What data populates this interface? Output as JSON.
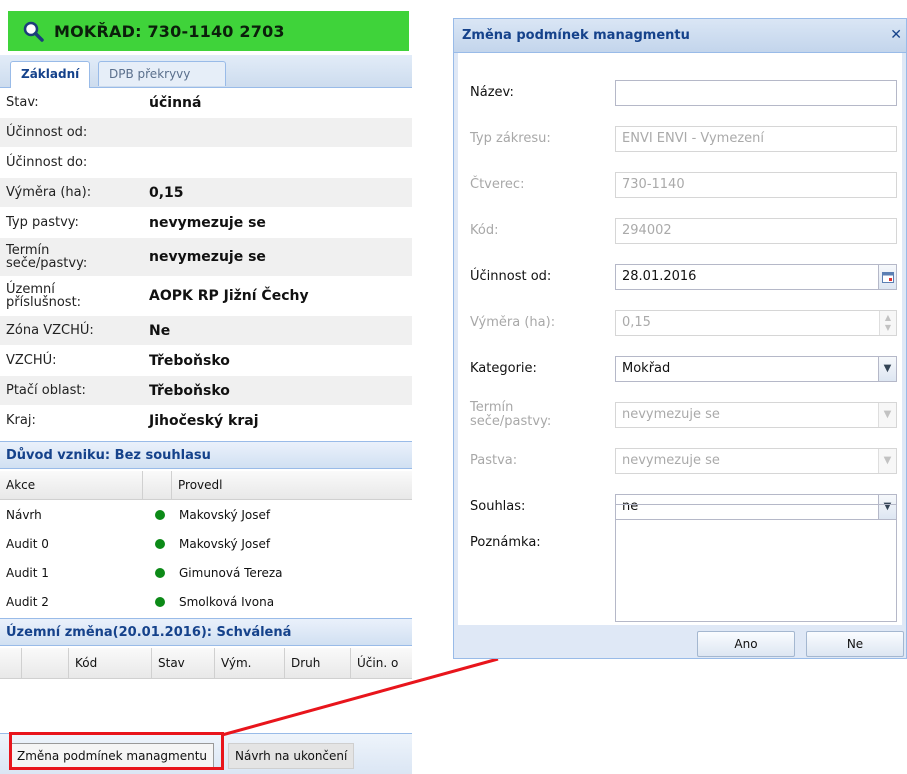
{
  "left": {
    "title": "MOKŘAD: 730-1140 2703",
    "tabs": [
      "Základní",
      "DPB překryvy"
    ],
    "properties": [
      {
        "label": "Stav:",
        "value": "účinná"
      },
      {
        "label": "Účinnost od:",
        "value": ""
      },
      {
        "label": "Účinnost do:",
        "value": ""
      },
      {
        "label": "Výměra (ha):",
        "value": "0,15"
      },
      {
        "label": "Typ pastvy:",
        "value": "nevymezuje se"
      },
      {
        "label": "Termín seče/pastvy:",
        "value": "nevymezuje se"
      },
      {
        "label": "Územní příslušnost:",
        "value": "AOPK RP Jižní Čechy"
      },
      {
        "label": "Zóna VZCHÚ:",
        "value": "Ne"
      },
      {
        "label": "VZCHÚ:",
        "value": "Třeboňsko"
      },
      {
        "label": "Ptačí oblast:",
        "value": "Třeboňsko"
      },
      {
        "label": "Kraj:",
        "value": "Jihočeský kraj"
      }
    ],
    "duvod_header": "Důvod vzniku: Bez souhlasu",
    "audit_columns": [
      "Akce",
      "Provedl"
    ],
    "audit_rows": [
      {
        "akce": "Návrh",
        "provedl": "Makovský Josef"
      },
      {
        "akce": "Audit 0",
        "provedl": "Makovský Josef"
      },
      {
        "akce": "Audit 1",
        "provedl": "Gimunová Tereza"
      },
      {
        "akce": "Audit 2",
        "provedl": "Smolková Ivona"
      }
    ],
    "status_color": "#0c8a17",
    "zmena_header": "Územní změna(20.01.2016): Schválená",
    "zmena_columns": [
      "",
      "Kód",
      "Stav",
      "Vým.",
      "Druh",
      "Účin. o"
    ],
    "toolbar": {
      "zmena_btn": "Změna podmínek managmentu",
      "navrh_btn": "Návrh na ukončení"
    }
  },
  "dialog": {
    "title": "Změna podmínek managmentu",
    "close_glyph": "✕",
    "fields": {
      "nazev": {
        "label": "Název:",
        "value": ""
      },
      "typ": {
        "label": "Typ zákresu:",
        "value": "ENVI ENVI - Vymezení"
      },
      "ctverec": {
        "label": "Čtverec:",
        "value": "730-1140"
      },
      "kod": {
        "label": "Kód:",
        "value": "294002"
      },
      "ucinnost": {
        "label": "Účinnost od:",
        "value": "28.01.2016"
      },
      "vymera": {
        "label": "Výměra (ha):",
        "value": "0,15"
      },
      "kategorie": {
        "label": "Kategorie:",
        "value": "Mokřad"
      },
      "termin": {
        "label": "Termín seče/pastvy:",
        "value": "nevymezuje se"
      },
      "pastva": {
        "label": "Pastva:",
        "value": "nevymezuje se"
      },
      "souhlas": {
        "label": "Souhlas:",
        "value": "ne"
      },
      "poznamka": {
        "label": "Poznámka:",
        "value": ""
      }
    },
    "buttons": {
      "ano": "Ano",
      "ne": "Ne"
    }
  },
  "colors": {
    "header_green": "#3fd33a",
    "highlight_red": "#e8151c",
    "accent_blue": "#15428b"
  }
}
